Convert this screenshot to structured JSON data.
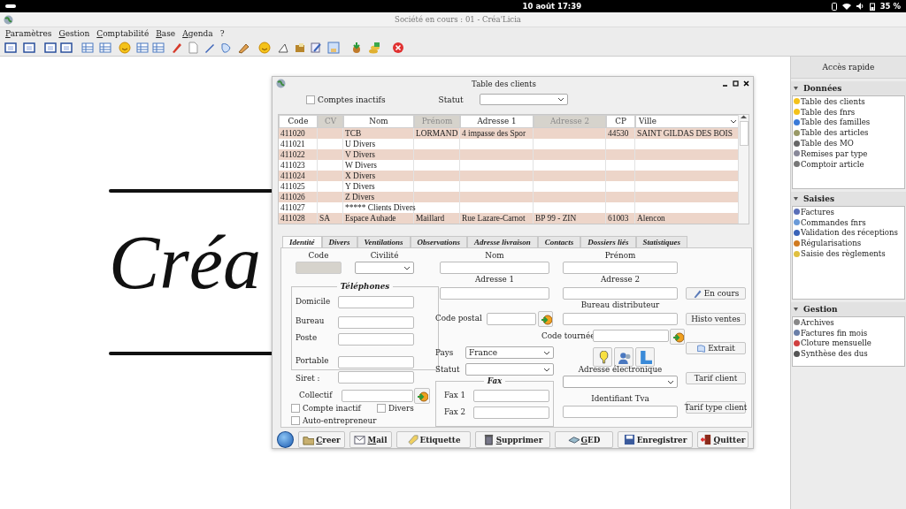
{
  "system_bar": {
    "clock": "10 août 17:39",
    "battery": "35 %"
  },
  "app": {
    "title": "Société en cours : 01 - Créa'Licia"
  },
  "menu": [
    "Paramètres",
    "Gestion",
    "Comptabilité",
    "Base",
    "Agenda",
    "?"
  ],
  "logo": {
    "text": "Créa"
  },
  "quick_access": {
    "title": "Accès rapide",
    "sections": [
      {
        "title": "Données",
        "expanded": true,
        "items": [
          "Table des clients",
          "Table des fnrs",
          "Table des familles",
          "Table des articles",
          "Table des MO",
          "Remises par type",
          "Comptoir article"
        ]
      },
      {
        "title": "Saisies",
        "expanded": true,
        "items": [
          "Factures",
          "Commandes fnrs",
          "Validation des réceptions",
          "Régularisations",
          "Saisie des règlements"
        ]
      },
      {
        "title": "Gestion",
        "expanded": true,
        "items": [
          "Archives",
          "Factures fin mois",
          "Cloture mensuelle",
          "Synthèse des dus"
        ]
      }
    ]
  },
  "dialog": {
    "title": "Table des clients",
    "inactive_filter": {
      "label": "Comptes inactifs",
      "checked": false
    },
    "status_filter": {
      "label": "Statut"
    },
    "table": {
      "columns": [
        {
          "label": "Code",
          "greyed": false
        },
        {
          "label": "CV",
          "greyed": true
        },
        {
          "label": "Nom",
          "greyed": false
        },
        {
          "label": "Prénom",
          "greyed": true
        },
        {
          "label": "Adresse 1",
          "greyed": false
        },
        {
          "label": "Adresse 2",
          "greyed": true
        },
        {
          "label": "CP",
          "greyed": false
        },
        {
          "label": "Ville",
          "greyed": false
        }
      ],
      "rows": [
        {
          "code": "411020",
          "nom": "TCB",
          "prenom": "LORMAND",
          "adresse_1": "4 impasse des Spor",
          "cp": "44530",
          "ville": "SAINT GILDAS DES BOIS"
        },
        {
          "code": "411021",
          "nom": "U Divers"
        },
        {
          "code": "411022",
          "nom": "V Divers"
        },
        {
          "code": "411023",
          "nom": "W Divers"
        },
        {
          "code": "411024",
          "nom": "X Divers"
        },
        {
          "code": "411025",
          "nom": "Y Divers"
        },
        {
          "code": "411026",
          "nom": "Z Divers"
        },
        {
          "code": "411027",
          "nom": "***** Clients Divers"
        },
        {
          "code": "411028",
          "cv": "SA",
          "nom": "Espace Auhade",
          "prenom": "Maillard",
          "adresse_1": "Rue Lazare-Carnot",
          "adresse_2": "BP 99 - ZIN",
          "cp": "61003",
          "ville": "Alencon"
        }
      ]
    },
    "tabs": [
      {
        "label": "Identité",
        "selected": true
      },
      {
        "label": "Divers",
        "selected": false
      },
      {
        "label": "Ventilations",
        "selected": false
      },
      {
        "label": "Observations",
        "selected": false
      },
      {
        "label": "Adresse livraison",
        "selected": false
      },
      {
        "label": "Contacts",
        "selected": false
      },
      {
        "label": "Dossiers liés",
        "selected": false
      },
      {
        "label": "Statistiques",
        "selected": false
      }
    ],
    "form": [
      {
        "kind": "label",
        "text": "Code"
      },
      {
        "kind": "label",
        "text": "Civilité"
      },
      {
        "kind": "label",
        "text": "Nom"
      },
      {
        "kind": "label",
        "text": "Prénom"
      },
      {
        "kind": "input",
        "disabled": true
      },
      {
        "kind": "select"
      },
      {
        "kind": "input",
        "disabled": false
      },
      {
        "kind": "input",
        "disabled": false
      },
      {
        "kind": "group",
        "title": "Téléphones"
      },
      {
        "kind": "label",
        "text": "Domicile"
      },
      {
        "kind": "input",
        "disabled": false
      },
      {
        "kind": "label",
        "text": "Bureau"
      },
      {
        "kind": "input",
        "disabled": false
      },
      {
        "kind": "label",
        "text": "Poste"
      },
      {
        "kind": "input",
        "disabled": false
      },
      {
        "kind": "label",
        "text": "Portable"
      },
      {
        "kind": "input",
        "disabled": false
      },
      {
        "kind": "label",
        "text": "Siret :"
      },
      {
        "kind": "input",
        "disabled": false
      },
      {
        "kind": "label",
        "text": "Collectif"
      },
      {
        "kind": "input",
        "disabled": false
      },
      {
        "kind": "lookup"
      },
      {
        "kind": "checkbox",
        "label": "Compte inactif",
        "checked": false
      },
      {
        "kind": "checkbox",
        "label": "Divers",
        "checked": false
      },
      {
        "kind": "checkbox",
        "label": "Auto-entrepreneur",
        "checked": false
      },
      {
        "kind": "label",
        "text": "Adresse 1"
      },
      {
        "kind": "input",
        "disabled": false
      },
      {
        "kind": "label",
        "text": "Adresse 2"
      },
      {
        "kind": "input",
        "disabled": false
      },
      {
        "kind": "label",
        "text": "Bureau distributeur"
      },
      {
        "kind": "label",
        "text": "Code postal"
      },
      {
        "kind": "input",
        "disabled": false
      },
      {
        "kind": "lookup"
      },
      {
        "kind": "input",
        "disabled": false
      },
      {
        "kind": "label",
        "text": "Code tournée"
      },
      {
        "kind": "input",
        "disabled": false
      },
      {
        "kind": "lookup"
      },
      {
        "kind": "iconbutton"
      },
      {
        "kind": "iconbutton"
      },
      {
        "kind": "iconbutton"
      },
      {
        "kind": "label",
        "text": "Pays"
      },
      {
        "kind": "select",
        "value": "France"
      },
      {
        "kind": "label",
        "text": "Statut"
      },
      {
        "kind": "select"
      },
      {
        "kind": "label",
        "text": "Adresse électronique"
      },
      {
        "kind": "select"
      },
      {
        "kind": "group",
        "title": "Fax"
      },
      {
        "kind": "label",
        "text": "Fax 1"
      },
      {
        "kind": "input",
        "disabled": false
      },
      {
        "kind": "label",
        "text": "Fax 2"
      },
      {
        "kind": "input",
        "disabled": false
      },
      {
        "kind": "label",
        "text": "Identifiant Tva"
      },
      {
        "kind": "input",
        "disabled": false
      },
      {
        "kind": "button",
        "label": "En cours"
      },
      {
        "kind": "button",
        "label": "Histo ventes"
      },
      {
        "kind": "button",
        "label": "Extrait"
      },
      {
        "kind": "button",
        "label": "Tarif client"
      },
      {
        "kind": "button",
        "label": "Tarif type client"
      }
    ],
    "actions": [
      {
        "label": "Creer",
        "underline": true
      },
      {
        "label": "Mail",
        "underline": true
      },
      {
        "label": "Etiquette",
        "underline": false
      },
      {
        "label": "Supprimer",
        "underline": true
      },
      {
        "label": "GED",
        "underline": true
      },
      {
        "label": "Enregistrer",
        "underline": false
      },
      {
        "label": "Quitter",
        "underline": true
      }
    ]
  }
}
